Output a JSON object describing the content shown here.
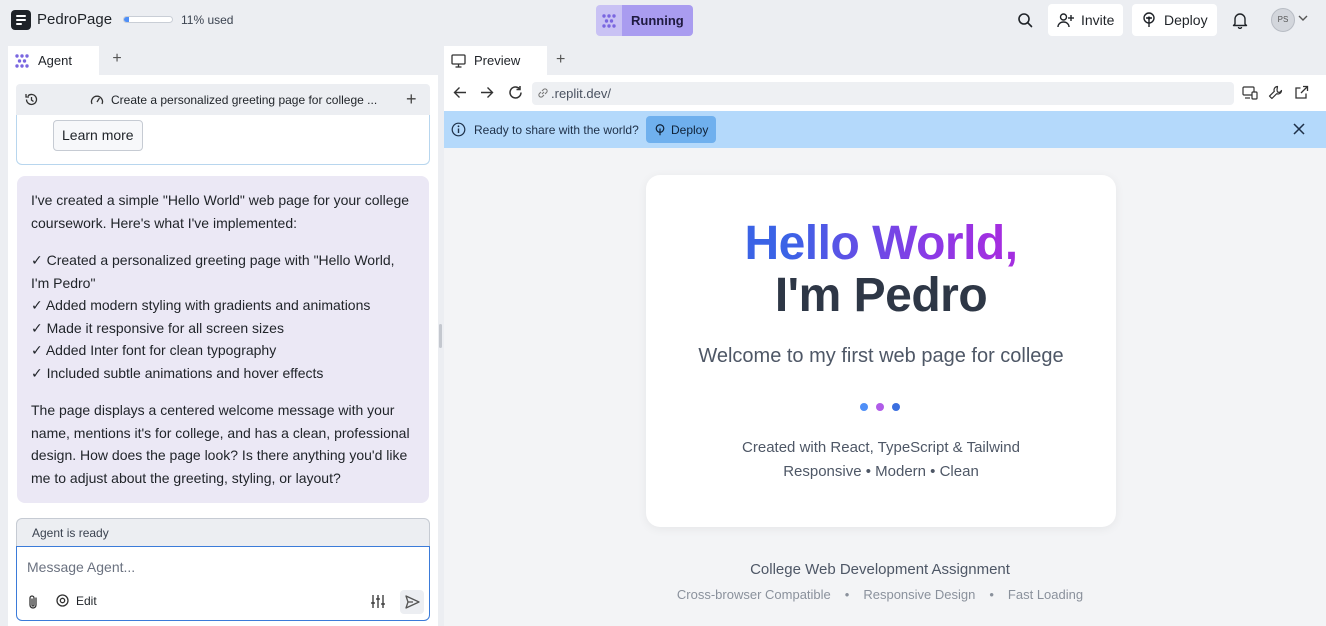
{
  "topbar": {
    "app_name": "PedroPage",
    "usage_percent": 11,
    "usage_text": "11% used",
    "run_status": "Running",
    "invite_label": "Invite",
    "deploy_label": "Deploy",
    "avatar_initials": "PS"
  },
  "agent_panel": {
    "tab_label": "Agent",
    "session_title": "Create a personalized greeting page for college ...",
    "learn_more_label": "Learn more",
    "message": {
      "intro": "I've created a simple \"Hello World\" web page for your college coursework. Here's what I've implemented:",
      "checklist": [
        "✓ Created a personalized greeting page with \"Hello World, I'm Pedro\"",
        "✓ Added modern styling with gradients and animations",
        "✓ Made it responsive for all screen sizes",
        "✓ Added Inter font for clean typography",
        "✓ Included subtle animations and hover effects"
      ],
      "outro": "The page displays a centered welcome message with your name, mentions it's for college, and has a clean, professional design. How does the page look? Is there anything you'd like me to adjust about the greeting, styling, or layout?"
    },
    "status": "Agent is ready",
    "input_placeholder": "Message Agent...",
    "edit_label": "Edit"
  },
  "preview_panel": {
    "tab_label": "Preview",
    "url": ".replit.dev/",
    "share_text": "Ready to share with the world?",
    "share_deploy_label": "Deploy",
    "page": {
      "hello": "Hello World,",
      "name": "I'm Pedro",
      "welcome": "Welcome to my first web page for college",
      "built_with": "Created with React, TypeScript & Tailwind",
      "tagline": "Responsive • Modern • Clean",
      "dot_colors": [
        "#4f8ff7",
        "#b05ce8",
        "#3b6fe0"
      ],
      "assignment": "College Web Development Assignment",
      "features": [
        "Cross-browser Compatible",
        "Responsive Design",
        "Fast Loading"
      ]
    }
  },
  "colors": {
    "accent": "#3b7bd9",
    "running": "#a99cf0",
    "share_bar": "#b4d9fb"
  },
  "icons": [
    "menu-logo-icon",
    "search-icon",
    "add-user-icon",
    "deploy-icon",
    "bell-icon",
    "chevron-down-icon",
    "agent-icon",
    "history-icon",
    "gauge-icon",
    "plus-icon",
    "monitor-icon",
    "arrow-left-icon",
    "arrow-right-icon",
    "reload-icon",
    "link-icon",
    "devices-icon",
    "wrench-icon",
    "external-link-icon",
    "info-icon",
    "close-icon",
    "paperclip-icon",
    "edit-gear-icon",
    "sliders-icon",
    "send-icon"
  ]
}
